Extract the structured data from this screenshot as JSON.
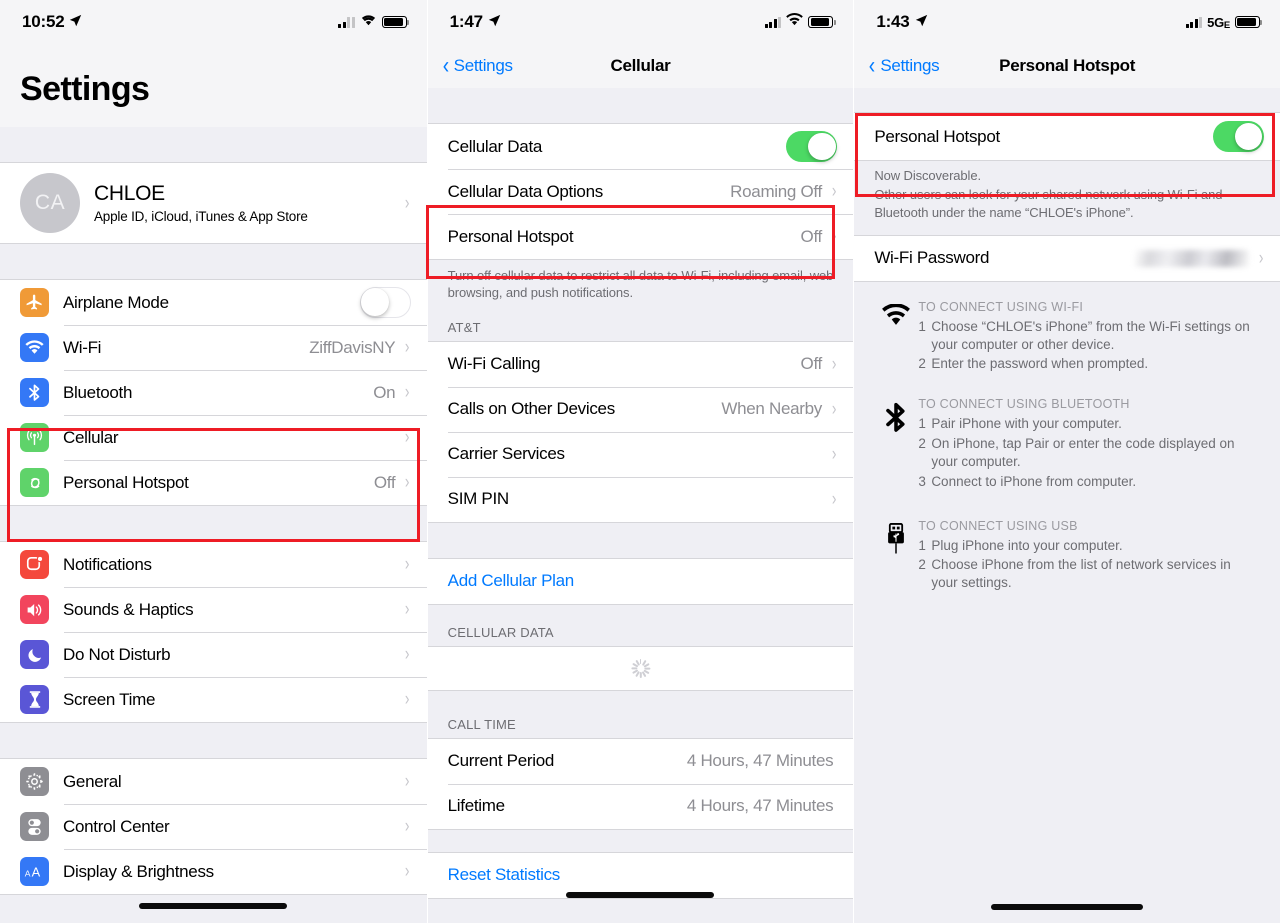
{
  "panels": [
    {
      "id": "settings-root",
      "status": {
        "time": "10:52",
        "location_arrow": "location-arrow-icon",
        "network": "",
        "signal_bars": 2,
        "wifi": true,
        "battery": "battery-full-icon"
      },
      "title": "Settings",
      "account": {
        "initials": "CA",
        "name": "CHLOE",
        "subtitle": "Apple ID, iCloud, iTunes & App Store"
      },
      "groups": [
        {
          "rows": [
            {
              "icon": "airplane-icon",
              "label": "Airplane Mode",
              "value": "",
              "control": "toggle-off"
            },
            {
              "icon": "wifi-icon",
              "label": "Wi-Fi",
              "value": "ZiffDavisNY",
              "control": "chevron"
            },
            {
              "icon": "bluetooth-icon",
              "label": "Bluetooth",
              "value": "On",
              "control": "chevron"
            },
            {
              "icon": "cellular-icon",
              "label": "Cellular",
              "value": "",
              "control": "chevron"
            },
            {
              "icon": "hotspot-icon",
              "label": "Personal Hotspot",
              "value": "Off",
              "control": "chevron"
            }
          ]
        },
        {
          "rows": [
            {
              "icon": "notifications-icon",
              "label": "Notifications",
              "value": "",
              "control": "chevron"
            },
            {
              "icon": "sounds-icon",
              "label": "Sounds & Haptics",
              "value": "",
              "control": "chevron"
            },
            {
              "icon": "dnd-icon",
              "label": "Do Not Disturb",
              "value": "",
              "control": "chevron"
            },
            {
              "icon": "screentime-icon",
              "label": "Screen Time",
              "value": "",
              "control": "chevron"
            }
          ]
        },
        {
          "rows": [
            {
              "icon": "general-icon",
              "label": "General",
              "value": "",
              "control": "chevron"
            },
            {
              "icon": "controlcenter-icon",
              "label": "Control Center",
              "value": "",
              "control": "chevron"
            },
            {
              "icon": "display-icon",
              "label": "Display & Brightness",
              "value": "",
              "control": "chevron"
            }
          ]
        }
      ]
    },
    {
      "id": "cellular",
      "status": {
        "time": "1:47",
        "location_arrow": "location-arrow-icon",
        "network": "",
        "signal_bars": 3,
        "wifi": true,
        "battery": "battery-full-icon"
      },
      "nav": {
        "back_label": "Settings",
        "title": "Cellular"
      },
      "rows_main": [
        {
          "label": "Cellular Data",
          "value": "",
          "control": "toggle-on"
        },
        {
          "label": "Cellular Data Options",
          "value": "Roaming Off",
          "control": "chevron"
        },
        {
          "label": "Personal Hotspot",
          "value": "Off",
          "control": "chevron"
        }
      ],
      "footer_main": "Turn off cellular data to restrict all data to Wi-Fi, including email, web browsing, and push notifications.",
      "carrier_header": "AT&T",
      "rows_carrier": [
        {
          "label": "Wi-Fi Calling",
          "value": "Off",
          "control": "chevron"
        },
        {
          "label": "Calls on Other Devices",
          "value": "When Nearby",
          "control": "chevron"
        },
        {
          "label": "Carrier Services",
          "value": "",
          "control": "chevron"
        },
        {
          "label": "SIM PIN",
          "value": "",
          "control": "chevron"
        }
      ],
      "add_plan_label": "Add Cellular Plan",
      "cellular_data_header": "CELLULAR DATA",
      "cellular_data_loading": "loading-spinner-icon",
      "call_time_header": "CALL TIME",
      "rows_calltime": [
        {
          "label": "Current Period",
          "value": "4 Hours, 47 Minutes"
        },
        {
          "label": "Lifetime",
          "value": "4 Hours, 47 Minutes"
        }
      ],
      "reset_label": "Reset Statistics"
    },
    {
      "id": "personal-hotspot",
      "status": {
        "time": "1:43",
        "location_arrow": "location-arrow-icon",
        "network": "5G",
        "network_suffix": "E",
        "signal_bars": 3,
        "wifi": false,
        "battery": "battery-full-icon"
      },
      "nav": {
        "back_label": "Settings",
        "title": "Personal Hotspot"
      },
      "hotspot_row": {
        "label": "Personal Hotspot",
        "control": "toggle-on"
      },
      "discover_note": "Now Discoverable.",
      "footer_note": "Other users can look for your shared network using Wi-Fi and Bluetooth under the name “CHLOE's iPhone”.",
      "wifi_password_row": {
        "label": "Wi-Fi Password",
        "value_masked": true
      },
      "instructions": [
        {
          "icon": "wifi-icon",
          "heading": "TO CONNECT USING WI-FI",
          "steps": [
            {
              "n": "1",
              "text": "Choose “CHLOE's iPhone” from the Wi-Fi settings on your computer or other device."
            },
            {
              "n": "2",
              "text": "Enter the password when prompted."
            }
          ]
        },
        {
          "icon": "bluetooth-icon",
          "heading": "TO CONNECT USING BLUETOOTH",
          "steps": [
            {
              "n": "1",
              "text": "Pair iPhone with your computer."
            },
            {
              "n": "2",
              "text": "On iPhone, tap Pair or enter the code displayed on your computer."
            },
            {
              "n": "3",
              "text": "Connect to iPhone from computer."
            }
          ]
        },
        {
          "icon": "usb-icon",
          "heading": "TO CONNECT USING USB",
          "steps": [
            {
              "n": "1",
              "text": "Plug iPhone into your computer."
            },
            {
              "n": "2",
              "text": "Choose iPhone from the list of network services in your settings."
            }
          ]
        }
      ]
    }
  ],
  "colors": {
    "accent_blue": "#007aff",
    "toggle_on_green": "#4cd964",
    "annotation_red": "#ee1c25",
    "group_bg": "#efeff4",
    "secondary_text": "#8e8e93"
  }
}
